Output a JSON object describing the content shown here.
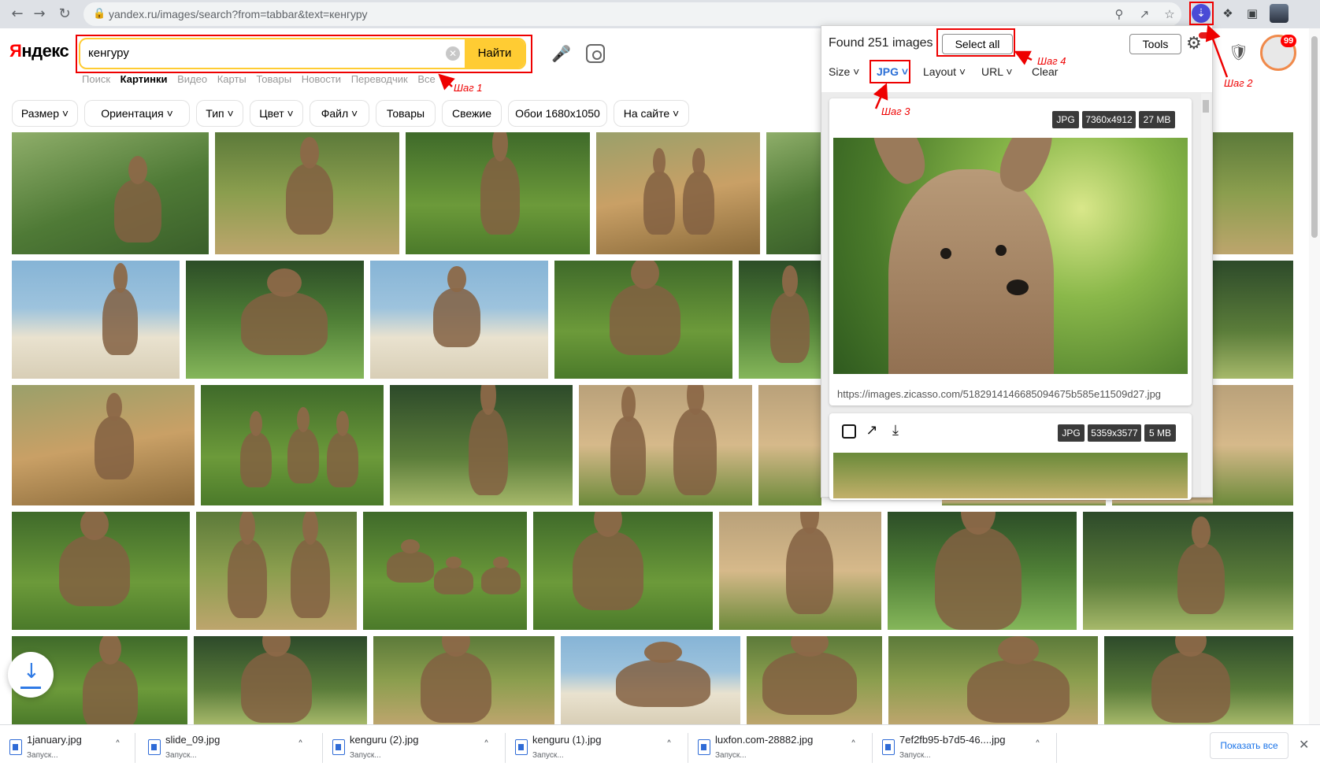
{
  "browser": {
    "url": "yandex.ru/images/search?from=tabbar&text=кенгуру",
    "icons": {
      "back": "back-arrow-icon",
      "forward": "forward-arrow-icon",
      "reload": "reload-icon",
      "lock": "lock-icon",
      "zoom": "zoom-icon",
      "share": "share-icon",
      "bookmark": "star-icon",
      "extension": "image-downloader-icon",
      "puzzle": "puzzle-icon",
      "sidepanel": "sidepanel-icon",
      "profile": "profile-icon"
    }
  },
  "yandex": {
    "logo_first": "Я",
    "logo_rest": "ндекс",
    "query": "кенгуру",
    "search_button": "Найти",
    "services": [
      "Поиск",
      "Картинки",
      "Видео",
      "Карты",
      "Товары",
      "Новости",
      "Переводчик",
      "Все"
    ],
    "filters": [
      "Размер",
      "Ориентация",
      "Тип",
      "Цвет",
      "Файл",
      "Товары",
      "Свежие",
      "Обои 1680x1050",
      "На сайте"
    ],
    "notification_count": "99"
  },
  "popup": {
    "found_text": "Found 251 images",
    "select_all": "Select all",
    "tools": "Tools",
    "menu": {
      "size": "Size",
      "jpg": "JPG",
      "layout": "Layout",
      "url": "URL",
      "clear": "Clear"
    },
    "cards": [
      {
        "format": "JPG",
        "dimensions": "7360x4912",
        "size": "27 MB",
        "url": "https://images.zicasso.com/5182914146685094675b585e11509d27.jpg"
      },
      {
        "format": "JPG",
        "dimensions": "5359x3577",
        "size": "5 MB"
      }
    ]
  },
  "annotations": {
    "step1": "Шаг 1",
    "step2": "Шаг 2",
    "step3": "Шаг 3",
    "step4": "Шаг 4"
  },
  "downloads": {
    "items": [
      {
        "name": "1january.jpg",
        "status": "Запуск..."
      },
      {
        "name": "slide_09.jpg",
        "status": "Запуск..."
      },
      {
        "name": "kenguru (2).jpg",
        "status": "Запуск..."
      },
      {
        "name": "kenguru (1).jpg",
        "status": "Запуск..."
      },
      {
        "name": "luxfon.com-28882.jpg",
        "status": "Запуск..."
      },
      {
        "name": "7ef2fb95-b7d5-46....jpg",
        "status": "Запуск..."
      }
    ],
    "show_all": "Показать все"
  },
  "colors": {
    "accent_yellow": "#ffcc33",
    "annotation_red": "#e00000",
    "extension_purple": "#4a4bd6"
  }
}
